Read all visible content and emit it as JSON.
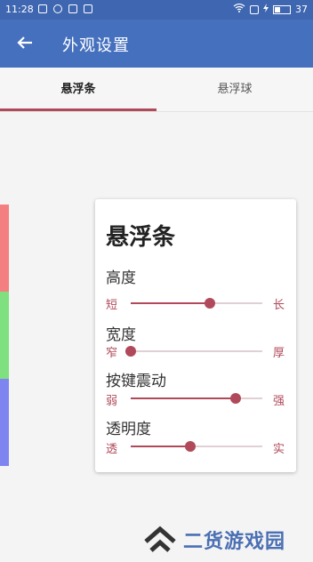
{
  "status_bar": {
    "time": "11:28",
    "battery": "37"
  },
  "app_bar": {
    "title": "外观设置"
  },
  "tabs": [
    {
      "label": "悬浮条",
      "active": true
    },
    {
      "label": "悬浮球",
      "active": false
    }
  ],
  "preview_strip": {
    "colors": [
      "#f47f80",
      "#7fe07f",
      "#7f85f0"
    ]
  },
  "card": {
    "title": "悬浮条",
    "settings": [
      {
        "label": "高度",
        "min": "短",
        "max": "长",
        "value": 0.6
      },
      {
        "label": "宽度",
        "min": "窄",
        "max": "厚",
        "value": 0.0
      },
      {
        "label": "按键震动",
        "min": "弱",
        "max": "强",
        "value": 0.8
      },
      {
        "label": "透明度",
        "min": "透",
        "max": "实",
        "value": 0.45
      }
    ]
  },
  "watermark": {
    "text": "二货游戏园"
  },
  "colors": {
    "accent": "#b04a5a",
    "primary": "#4570be",
    "status_bar": "#3f66b0"
  }
}
